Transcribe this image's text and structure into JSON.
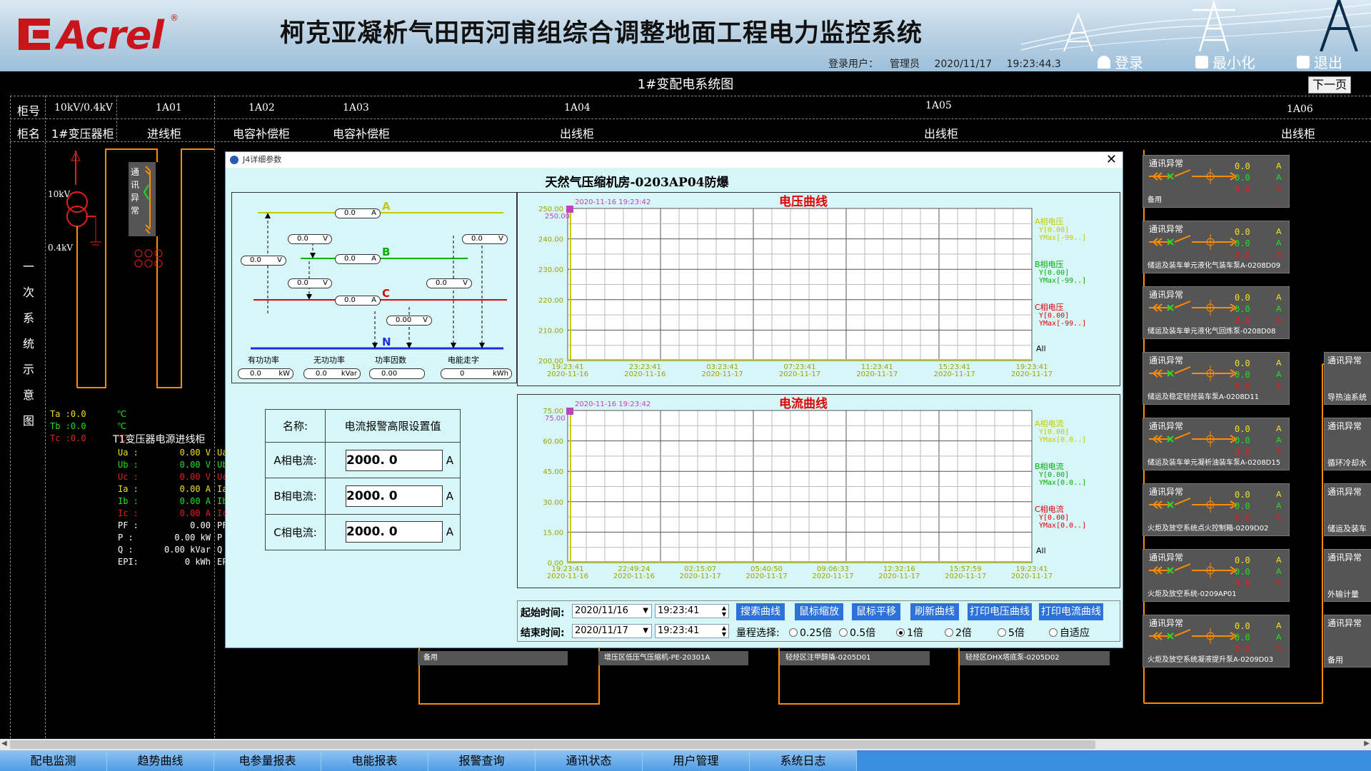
{
  "header": {
    "brand": "Acrel",
    "title": "柯克亚凝析气田西河甫组综合调整地面工程电力监控系统",
    "login_label": "登录用户：",
    "login_user": "管理员",
    "date": "2020/11/17",
    "time": "19:23:44.3",
    "btn_login": "登录",
    "btn_minimize": "最小化",
    "btn_exit": "退出"
  },
  "diagram": {
    "title": "1#变配电系统图",
    "next_page": "下一页",
    "row_label_no": "柜号",
    "row_label_name": "柜名",
    "columns": [
      {
        "no": "10kV/0.4kV",
        "name": "1#变压器柜"
      },
      {
        "no": "1A01",
        "name": "进线柜"
      },
      {
        "no": "1A02",
        "name": "电容补偿柜"
      },
      {
        "no": "1A03",
        "name": "电容补偿柜"
      },
      {
        "no": "1A04",
        "name": "出线柜"
      },
      {
        "no": "1A05",
        "name": "出线柜"
      },
      {
        "no": "1A06",
        "name": "出线柜"
      }
    ],
    "side_label": [
      "一",
      "次",
      "系",
      "统",
      "示",
      "意",
      "图"
    ],
    "transformer_hv": "10kV",
    "transformer_lv": "0.4kV",
    "comm_abnormal_vertical": [
      "通",
      "讯",
      "异",
      "常"
    ],
    "temps": [
      {
        "l": "Ta :0.0",
        "u": "℃"
      },
      {
        "l": "Tb :0.0",
        "u": "℃"
      },
      {
        "l": "Tc :0.0",
        "u": "℃"
      }
    ],
    "meter_title": "T1变压器电源进线柜",
    "meter_rows": [
      {
        "k": "Ua :",
        "v": "0.00 V",
        "c": "#f0e020"
      },
      {
        "k": "Ub :",
        "v": "0.00 V",
        "c": "#20e020"
      },
      {
        "k": "Uc :",
        "v": "0.00 V",
        "c": "#e02020"
      },
      {
        "k": "Ia :",
        "v": "0.00 A",
        "c": "#f0e020"
      },
      {
        "k": "Ib :",
        "v": "0.00 A",
        "c": "#20e020"
      },
      {
        "k": "Ic :",
        "v": "0.00 A",
        "c": "#e02020"
      },
      {
        "k": "PF :",
        "v": "0.00",
        "c": "#ffffff"
      },
      {
        "k": "P  :",
        "v": "0.00 kW",
        "c": "#ffffff"
      },
      {
        "k": "Q  :",
        "v": "0.00 kVar",
        "c": "#ffffff"
      },
      {
        "k": "EPI:",
        "v": "0 kWh",
        "c": "#ffffff"
      }
    ],
    "meter2_keys": [
      "Ua",
      "Ub",
      "Uc",
      "Ia",
      "Ib",
      "Ic",
      "PF",
      "P",
      "Q",
      "EP"
    ],
    "right_panels": [
      {
        "status": "通讯异常",
        "name": "备用",
        "v": [
          "0.0",
          "0.0",
          "0.0"
        ],
        "u": "A"
      },
      {
        "status": "通讯异常",
        "name": "储运及装车单元液化气装车泵A-0208D09",
        "v": [
          "0.0",
          "0.0",
          "0.0"
        ],
        "u": "A"
      },
      {
        "status": "通讯异常",
        "name": "储运及装车单元液化气回炼泵-0208D08",
        "v": [
          "0.0",
          "0.0",
          "0.0"
        ],
        "u": "A"
      },
      {
        "status": "通讯异常",
        "name": "储运及稳定轻烃装车泵A-0208D11",
        "v": [
          "0.0",
          "0.0",
          "0.0"
        ],
        "u": "A"
      },
      {
        "status": "通讯异常",
        "name": "储运及装车单元凝析油装车泵A-0208D15",
        "v": [
          "0.0",
          "0.0",
          "0.0"
        ],
        "u": "A"
      },
      {
        "status": "通讯异常",
        "name": "火炬及放空系统点火控制箱-0209D02",
        "v": [
          "0.0",
          "0.0",
          "0.0"
        ],
        "u": "A"
      },
      {
        "status": "通讯异常",
        "name": "火炬及放空系统-0209AP01",
        "v": [
          "0.0",
          "0.0",
          "0.0"
        ],
        "u": "A"
      },
      {
        "status": "通讯异常",
        "name": "火炬及放空系统凝液提升泵A-0209D03",
        "v": [
          "0.0",
          "0.0",
          "0.0"
        ],
        "u": "A"
      }
    ],
    "far_right_panels": [
      {
        "status": "通讯异常",
        "name": "导热油系统"
      },
      {
        "status": "通讯异常",
        "name": "循环冷却水"
      },
      {
        "status": "通讯异常",
        "name": "储运及装车"
      },
      {
        "status": "通讯异常",
        "name": "外输计量"
      },
      {
        "status": "通讯异常",
        "name": "备用"
      }
    ],
    "bottom_panels": [
      "备用",
      "增压区低压气压缩机-PE-20301A",
      "轻烃区注甲醇撬-0205D01",
      "轻烃区DHX塔底泵-0205D02"
    ]
  },
  "modal": {
    "titlebar": "J4详细参数",
    "heading": "天然气压缩机房-0203AP04防爆",
    "diagram": {
      "phases": [
        "A",
        "B",
        "C",
        "N"
      ],
      "pills": [
        {
          "v": "0.0",
          "u": "A"
        },
        {
          "v": "0.0",
          "u": "V"
        },
        {
          "v": "0.0",
          "u": "V"
        },
        {
          "v": "0.0",
          "u": "V"
        },
        {
          "v": "0.0",
          "u": "A"
        },
        {
          "v": "0.0",
          "u": "V"
        },
        {
          "v": "0.0",
          "u": "V"
        },
        {
          "v": "0.0",
          "u": "A"
        },
        {
          "v": "0.00",
          "u": "V"
        }
      ],
      "measures": [
        {
          "label": "有功功率",
          "v": "0.0",
          "u": "kW"
        },
        {
          "label": "无功功率",
          "v": "0.0",
          "u": "kVar"
        },
        {
          "label": "功率因数",
          "v": "0.00",
          "u": ""
        },
        {
          "label": "电能走字",
          "v": "0",
          "u": "kWh"
        }
      ]
    },
    "alarm": {
      "name_label": "名称:",
      "name_value": "电流报警高限设置值",
      "rows": [
        {
          "label": "A相电流:",
          "value": "2000. 0",
          "unit": "A"
        },
        {
          "label": "B相电流:",
          "value": "2000. 0",
          "unit": "A"
        },
        {
          "label": "C相电流:",
          "value": "2000. 0",
          "unit": "A"
        }
      ]
    },
    "controls": {
      "start_label": "起始时间:",
      "start_date": "2020/11/16",
      "start_time": "19:23:41",
      "end_label": "结束时间:",
      "end_date": "2020/11/17",
      "end_time": "19:23:41",
      "buttons": [
        "搜索曲线",
        "鼠标缩放",
        "鼠标平移",
        "刷新曲线",
        "打印电压曲线",
        "打印电流曲线"
      ],
      "range_label": "量程选择:",
      "range_options": [
        "0.25倍",
        "0.5倍",
        "1倍",
        "2倍",
        "5倍",
        "自适应"
      ],
      "range_selected": "1倍"
    }
  },
  "chart_data": [
    {
      "type": "line",
      "title": "电压曲线",
      "cursor_label": "2020-11-16 19:23:42",
      "cursor_value": "250.00",
      "ylim": [
        200,
        250
      ],
      "yticks": [
        "250.00",
        "240.00",
        "230.00",
        "220.00",
        "210.00",
        "200.00"
      ],
      "xticks": [
        [
          "19:23:41",
          "2020-11-16"
        ],
        [
          "23:23:41",
          "2020-11-16"
        ],
        [
          "03:23:41",
          "2020-11-17"
        ],
        [
          "07:23:41",
          "2020-11-17"
        ],
        [
          "11:23:41",
          "2020-11-17"
        ],
        [
          "15:23:41",
          "2020-11-17"
        ],
        [
          "19:23:41",
          "2020-11-17"
        ]
      ],
      "series": [
        {
          "name": "A相电压",
          "y": "Y[0.00]",
          "ymax": "YMax[-99..]",
          "color": "#c8c800"
        },
        {
          "name": "B相电压",
          "y": "Y[0.00]",
          "ymax": "YMax[-99..]",
          "color": "#00b000"
        },
        {
          "name": "C相电压",
          "y": "Y[0.00]",
          "ymax": "YMax[-99..]",
          "color": "#e00000"
        }
      ],
      "all_label": "All",
      "grid": true
    },
    {
      "type": "line",
      "title": "电流曲线",
      "cursor_label": "2020-11-16 19:23:42",
      "cursor_value": "75.00",
      "ylim": [
        0,
        75
      ],
      "yticks": [
        "75.00",
        "60.00",
        "45.00",
        "30.00",
        "15.00",
        "0.00"
      ],
      "xticks": [
        [
          "19:23:41",
          "2020-11-16"
        ],
        [
          "22:49:24",
          "2020-11-16"
        ],
        [
          "02:15:07",
          "2020-11-17"
        ],
        [
          "05:40:50",
          "2020-11-17"
        ],
        [
          "09:06:33",
          "2020-11-17"
        ],
        [
          "12:32:16",
          "2020-11-17"
        ],
        [
          "15:57:59",
          "2020-11-17"
        ],
        [
          "19:23:41",
          "2020-11-17"
        ]
      ],
      "series": [
        {
          "name": "A相电流",
          "y": "Y[0.00]",
          "ymax": "YMax[0.0..]",
          "color": "#c8c800"
        },
        {
          "name": "B相电流",
          "y": "Y[0.00]",
          "ymax": "YMax[0.0..]",
          "color": "#00b000"
        },
        {
          "name": "C相电流",
          "y": "Y[0.00]",
          "ymax": "YMax[0.0..]",
          "color": "#e00000"
        }
      ],
      "all_label": "All",
      "grid": true
    }
  ],
  "tabs": [
    "配电监测",
    "趋势曲线",
    "电参量报表",
    "电能报表",
    "报警查询",
    "通讯状态",
    "用户管理",
    "系统日志"
  ]
}
